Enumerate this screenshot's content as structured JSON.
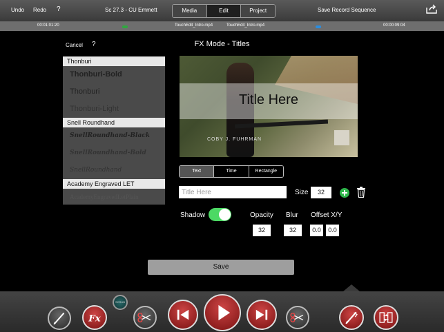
{
  "topbar": {
    "undo": "Undo",
    "redo": "Redo",
    "help": "?",
    "clip_title": "Sc 27.3 - CU Emmett",
    "tabs": [
      {
        "label": "Media",
        "active": false
      },
      {
        "label": "Edit",
        "active": true
      },
      {
        "label": "Project",
        "active": false
      }
    ],
    "save_sequence": "Save Record Sequence",
    "share_icon": "share-icon"
  },
  "timeline": {
    "timecode_in": "00:01:01:20",
    "clip_left": "TouchEdit_Intro.mp4",
    "clip_right": "TouchEdit_Intro.mp4",
    "timecode_out": "00:00:09:04",
    "marker_colors": {
      "green": "#2fa83f",
      "blue": "#2a8de0"
    }
  },
  "fx": {
    "title": "FX Mode - Titles",
    "cancel": "Cancel",
    "help": "?"
  },
  "fontlist": [
    {
      "type": "header",
      "label": "Thonburi"
    },
    {
      "type": "font",
      "label": "Thonburi-Bold",
      "style": "bold"
    },
    {
      "type": "font",
      "label": "Thonburi",
      "style": "regular"
    },
    {
      "type": "font",
      "label": "Thonburi-Light",
      "style": "light"
    },
    {
      "type": "header",
      "label": "Snell Roundhand"
    },
    {
      "type": "font",
      "label": "SnellRoundhand-Black",
      "style": "script-black"
    },
    {
      "type": "font",
      "label": "SnellRoundhand-Bold",
      "style": "script-bold"
    },
    {
      "type": "font",
      "label": "SnellRoundhand",
      "style": "script"
    },
    {
      "type": "header",
      "label": "Academy Engraved LET"
    },
    {
      "type": "font",
      "label": "AcademyEngravedLetPlain",
      "style": "engraved"
    }
  ],
  "preview": {
    "title_text": "Title Here",
    "watermark": "COBY J. FUHRMAN"
  },
  "mode_tabs": [
    {
      "label": "Text",
      "active": true
    },
    {
      "label": "Time",
      "active": false
    },
    {
      "label": "Rectangle",
      "active": false
    }
  ],
  "text_controls": {
    "placeholder": "Title Here",
    "size_label": "Size",
    "size_value": "32"
  },
  "shadow": {
    "label": "Shadow",
    "enabled": true,
    "opacity_label": "Opacity",
    "opacity_value": "32",
    "blur_label": "Blur",
    "blur_value": "32",
    "offset_label": "Offset X/Y",
    "offset_x": "0.0",
    "offset_y": "0.0"
  },
  "save_label": "Save",
  "bottombar": {
    "scrub_label": "SCRUB",
    "fx_label": "Fx"
  }
}
